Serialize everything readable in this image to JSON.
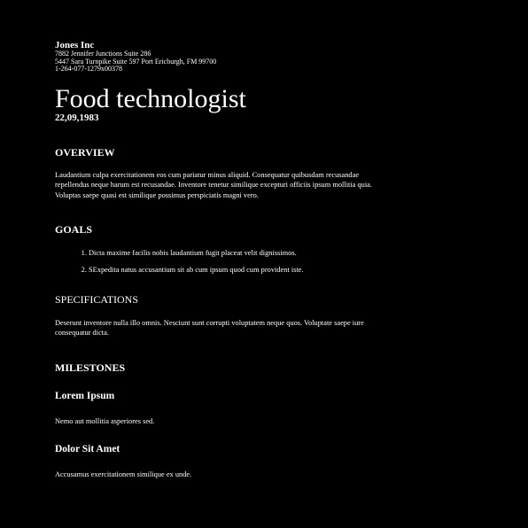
{
  "header": {
    "company": "Jones Inc",
    "address_line1": "7882 Jennifer Junctions Suite 286",
    "address_line2": "5447 Sara Turnpike Suite 597 Port Ericburgh, FM 99700",
    "phone": "1-264-077-1279x00378"
  },
  "title": "Food technologist",
  "date": "22,09,1983",
  "overview": {
    "heading": "OVERVIEW",
    "text": "Laudantium culpa exercitationem eos cum pariatur minus aliquid. Consequatur quibusdam recusandae repellendus neque harum est recusandae. Inventore tenetur similique excepturi officiis ipsum mollitia quia. Voluptas saepe quasi est similique possimus perspiciatis magni vero."
  },
  "goals": {
    "heading": "GOALS",
    "items": [
      "Dicta maxime facilis nobis laudantium fugit placeat velit dignissimos.",
      "SExpedita natus accusantium sit ab cum ipsum quod cum provident iste."
    ]
  },
  "specifications": {
    "heading": "SPECIFICATIONS",
    "text": "Deserunt inventore nulla illo omnis. Nesciunt sunt corrupti voluptatem neque quos. Voluptate saepe iure consequatur dicta."
  },
  "milestones": {
    "heading": "MILESTONES",
    "items": [
      {
        "title": "Lorem Ipsum",
        "text": "Nemo aut mollitia asperiores sed."
      },
      {
        "title": "Dolor Sit Amet",
        "text": "Accusamus exercitationem similique ex unde."
      }
    ]
  }
}
